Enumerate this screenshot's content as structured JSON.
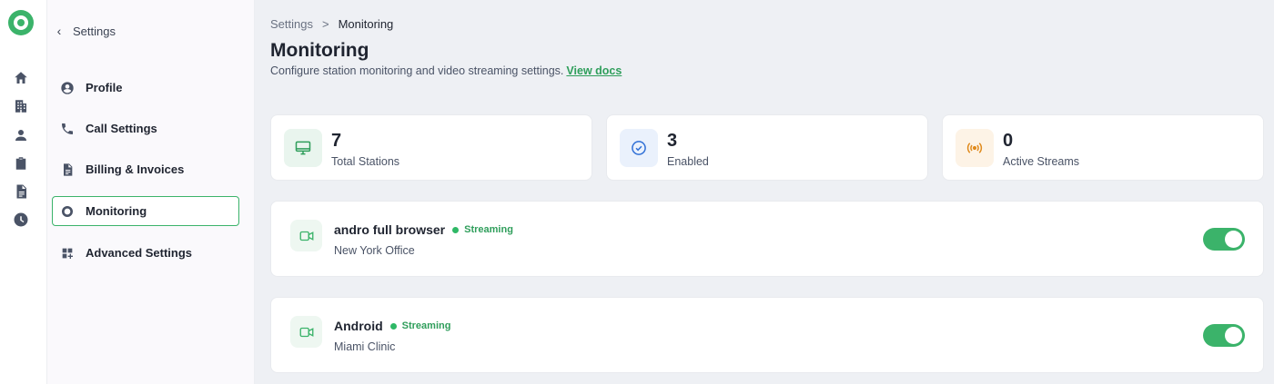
{
  "rail": {
    "icons": [
      "home-icon",
      "building-icon",
      "user-icon",
      "clipboard-check-icon",
      "document-icon",
      "clock-icon"
    ]
  },
  "sidebar": {
    "back_label": "Settings",
    "items": [
      {
        "label": "Profile",
        "icon": "user-circle-icon",
        "active": false
      },
      {
        "label": "Call Settings",
        "icon": "phone-icon",
        "active": false
      },
      {
        "label": "Billing & Invoices",
        "icon": "invoice-icon",
        "active": false
      },
      {
        "label": "Monitoring",
        "icon": "monitoring-icon",
        "active": true
      },
      {
        "label": "Advanced Settings",
        "icon": "apps-icon",
        "active": false
      }
    ]
  },
  "breadcrumb": {
    "parent": "Settings",
    "separator": ">",
    "current": "Monitoring"
  },
  "page": {
    "title": "Monitoring",
    "description": "Configure station monitoring and video streaming settings.",
    "docs_link": "View docs"
  },
  "stats": [
    {
      "value": "7",
      "label": "Total Stations",
      "icon": "monitor-icon",
      "color": "#2f9e5b",
      "bg": "#e9f5ee"
    },
    {
      "value": "3",
      "label": "Enabled",
      "icon": "check-circle-icon",
      "color": "#2f6fd6",
      "bg": "#eaf1fc"
    },
    {
      "value": "0",
      "label": "Active Streams",
      "icon": "broadcast-icon",
      "color": "#e08a1c",
      "bg": "#fdf3e6"
    }
  ],
  "stations": [
    {
      "name": "andro full browser",
      "status": "Streaming",
      "location": "New York Office",
      "enabled": true
    },
    {
      "name": "Android",
      "status": "Streaming",
      "location": "Miami Clinic",
      "enabled": true
    }
  ],
  "colors": {
    "accent": "#3bb36a",
    "streaming": "#2fb866"
  }
}
